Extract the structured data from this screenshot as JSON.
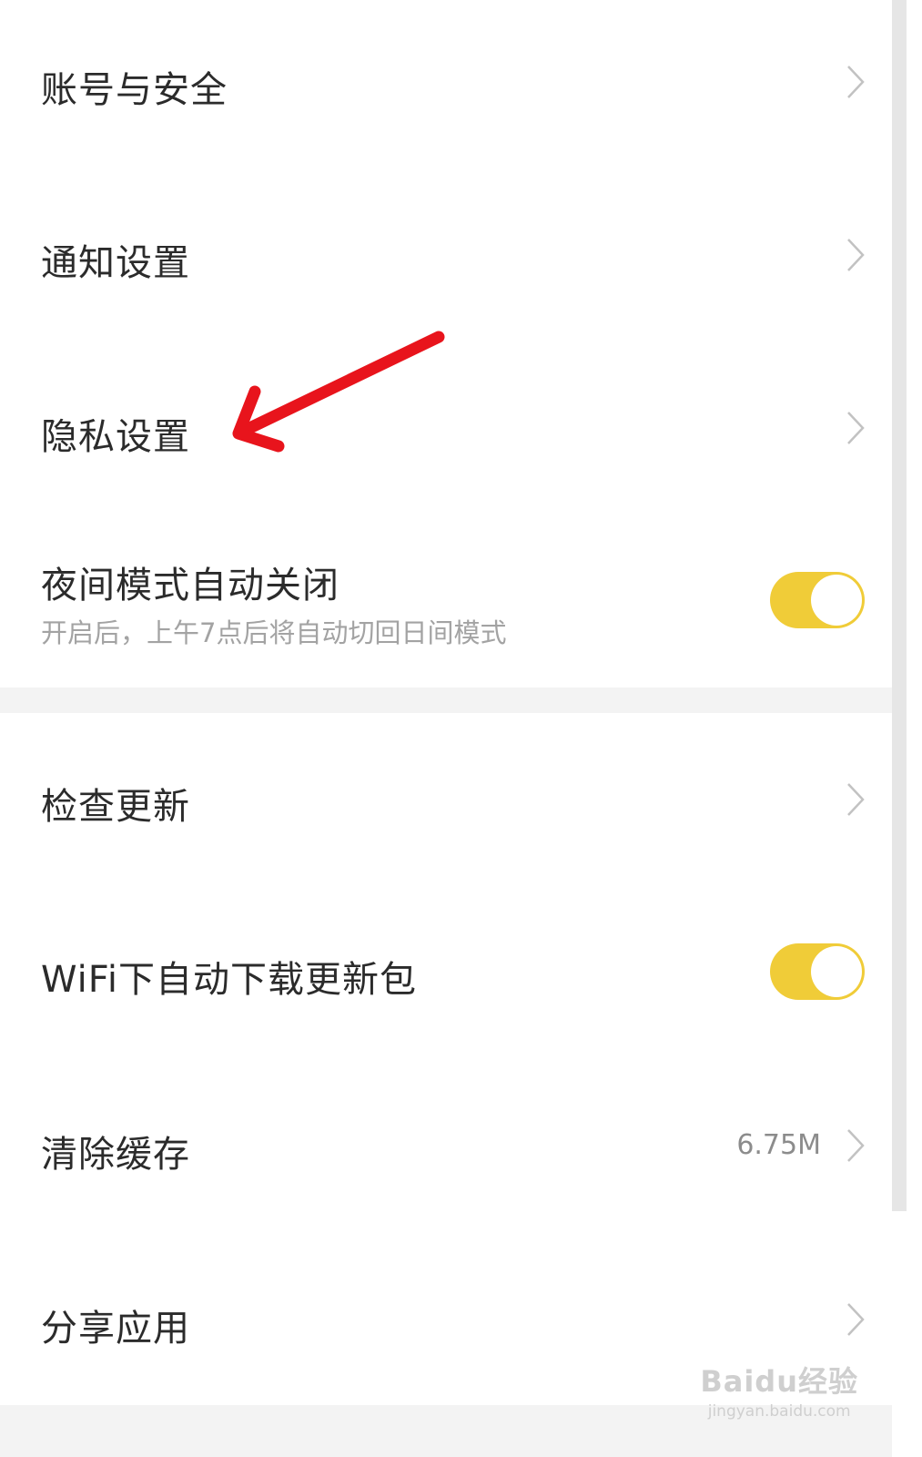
{
  "settings": {
    "items": [
      {
        "label": "账号与安全"
      },
      {
        "label": "通知设置"
      },
      {
        "label": "隐私设置"
      },
      {
        "label": "夜间模式自动关闭",
        "sublabel": "开启后，上午7点后将自动切回日间模式",
        "toggle": true
      },
      {
        "label": "检查更新"
      },
      {
        "label": "WiFi下自动下载更新包",
        "toggle": true
      },
      {
        "label": "清除缓存",
        "value": "6.75M"
      },
      {
        "label": "分享应用"
      }
    ]
  },
  "colors": {
    "toggle_on": "#f0cc38",
    "annotation_arrow": "#e8141c"
  },
  "icons": {
    "chevron": "chevron-right-icon"
  },
  "watermark": {
    "logo": "Baidu经验",
    "url": "jingyan.baidu.com"
  }
}
